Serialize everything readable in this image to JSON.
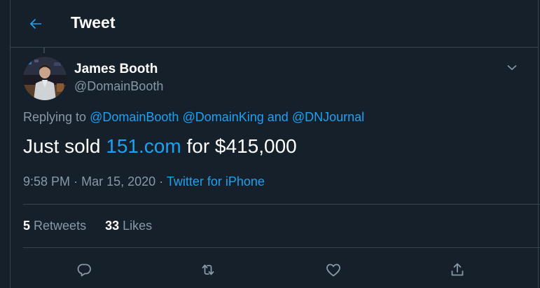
{
  "header": {
    "title": "Tweet",
    "back_icon": "arrow-left-icon",
    "accent_color": "#1da1f2"
  },
  "tweet": {
    "author": {
      "display_name": "James Booth",
      "handle": "@DomainBooth"
    },
    "replying": {
      "prefix": "Replying to",
      "mention_1": "@DomainBooth",
      "mention_2": "@DomainKing",
      "conjunction": "and",
      "mention_3": "@DNJournal"
    },
    "text": {
      "part_1": "Just sold",
      "link": "151.com",
      "part_2": "for $415,000"
    },
    "meta": {
      "time": "9:58 PM",
      "separator": "·",
      "date": "Mar 15, 2020",
      "source": "Twitter for iPhone"
    },
    "stats": {
      "retweets_count": "5",
      "retweets_label": "Retweets",
      "likes_count": "33",
      "likes_label": "Likes"
    },
    "actions": [
      "reply-icon",
      "retweet-icon",
      "like-icon",
      "share-icon"
    ]
  },
  "colors": {
    "background": "#15202b",
    "border": "#38444d",
    "secondary_text": "#8899a6",
    "link": "#1da1f2"
  }
}
